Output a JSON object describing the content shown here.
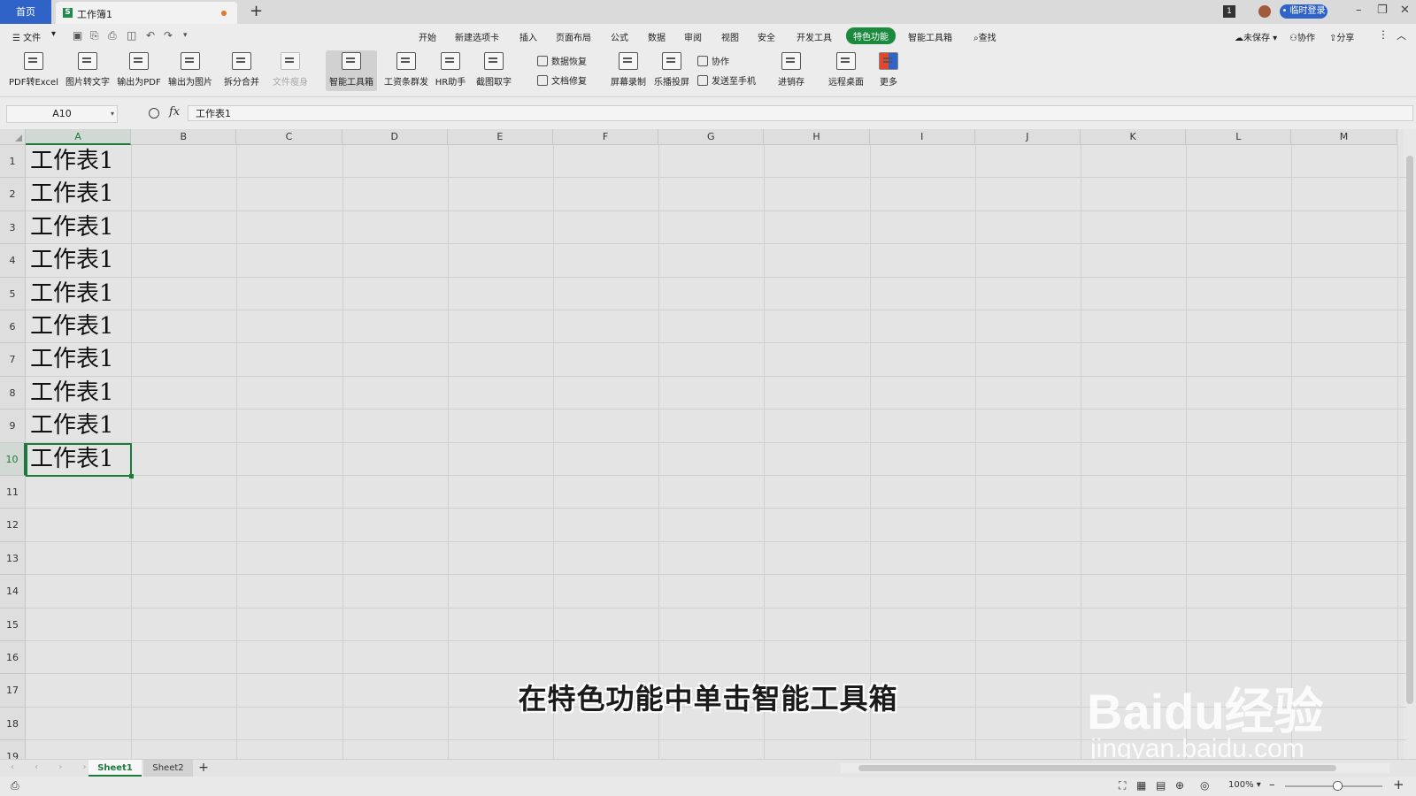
{
  "titlebar": {
    "home_tab": "首页",
    "doc_tab": "工作簿1",
    "doc_icon": "S",
    "new_tab": "+",
    "window_badge": "1",
    "login_button": "• 临时登录",
    "minimize": "–",
    "restore": "❐",
    "close": "✕"
  },
  "menubar": {
    "file_menu": "☰ 文件",
    "items": [
      "开始",
      "新建选项卡",
      "插入",
      "页面布局",
      "公式",
      "数据",
      "审阅",
      "视图",
      "安全",
      "开发工具",
      "特色功能",
      "智能工具箱"
    ],
    "active_item": "特色功能",
    "search": "查找",
    "unsaved": "未保存",
    "collaborate": "协作",
    "share": "分享"
  },
  "ribbon": {
    "buttons": [
      "PDF转Excel",
      "图片转文字",
      "输出为PDF",
      "输出为图片",
      "拆分合并",
      "文件瘦身",
      "智能工具箱",
      "工资条群发",
      "HR助手",
      "截图取字"
    ],
    "small_buttons": [
      "数据恢复",
      "文档修复"
    ],
    "buttons2": [
      "屏幕录制",
      "乐播投屏"
    ],
    "small_buttons2": [
      "协作",
      "发送至手机"
    ],
    "buttons3": [
      "进销存",
      "远程桌面",
      "更多"
    ]
  },
  "formula_bar": {
    "name_box": "A10",
    "fx": "fx",
    "content": "工作表1"
  },
  "grid": {
    "columns": [
      "A",
      "B",
      "C",
      "D",
      "E",
      "F",
      "G",
      "H",
      "I",
      "J",
      "K",
      "L",
      "M"
    ],
    "rows": [
      "1",
      "2",
      "3",
      "4",
      "5",
      "6",
      "7",
      "8",
      "9",
      "10",
      "11",
      "12",
      "13",
      "14",
      "15",
      "16",
      "17",
      "18",
      "19"
    ],
    "column_a_values": [
      "工作表1",
      "工作表1",
      "工作表1",
      "工作表1",
      "工作表1",
      "工作表1",
      "工作表1",
      "工作表1",
      "工作表1",
      "工作表1"
    ],
    "active_cell": "A10"
  },
  "overlay": {
    "subtitle": "在特色功能中单击智能工具箱",
    "watermark_logo": "Baidu经验",
    "watermark_url": "jingyan.baidu.com"
  },
  "sheets": {
    "tabs": [
      "Sheet1",
      "Sheet2"
    ],
    "active": "Sheet1",
    "add": "+"
  },
  "statusbar": {
    "zoom": "100%",
    "zoom_out": "–",
    "zoom_in": "+"
  },
  "colors": {
    "accent_green": "#1c7a3b",
    "home_tab_blue": "#2f63c8",
    "active_menu_green": "#1b8a3e"
  }
}
